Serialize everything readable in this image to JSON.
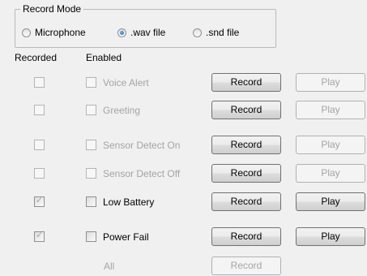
{
  "record_mode": {
    "legend": "Record Mode",
    "options": [
      {
        "label": "Microphone",
        "checked": false
      },
      {
        "label": ".wav file",
        "checked": true
      },
      {
        "label": ".snd file",
        "checked": false
      }
    ]
  },
  "headers": {
    "recorded": "Recorded",
    "enabled": "Enabled"
  },
  "rows": [
    {
      "label": "Voice Alert",
      "recorded": false,
      "enabled": false,
      "disabled": true,
      "record": "Record",
      "play": "Play",
      "play_enabled": false
    },
    {
      "label": "Greeting",
      "recorded": false,
      "enabled": false,
      "disabled": true,
      "record": "Record",
      "play": "Play",
      "play_enabled": false
    },
    {
      "label": "Sensor Detect On",
      "recorded": false,
      "enabled": false,
      "disabled": true,
      "record": "Record",
      "play": "Play",
      "play_enabled": false
    },
    {
      "label": "Sensor Detect Off",
      "recorded": false,
      "enabled": false,
      "disabled": true,
      "record": "Record",
      "play": "Play",
      "play_enabled": false
    },
    {
      "label": "Low Battery",
      "recorded": true,
      "enabled": false,
      "disabled": false,
      "record": "Record",
      "play": "Play",
      "play_enabled": true
    },
    {
      "label": "Power Fail",
      "recorded": true,
      "enabled": false,
      "disabled": false,
      "record": "Record",
      "play": "Play",
      "play_enabled": true
    }
  ],
  "all_row": {
    "label": "All",
    "record": "Record"
  },
  "colors": {
    "background": "#f0f0f0",
    "disabled_text": "#a4a4a4",
    "radio_selected": "#1f5fa8"
  }
}
